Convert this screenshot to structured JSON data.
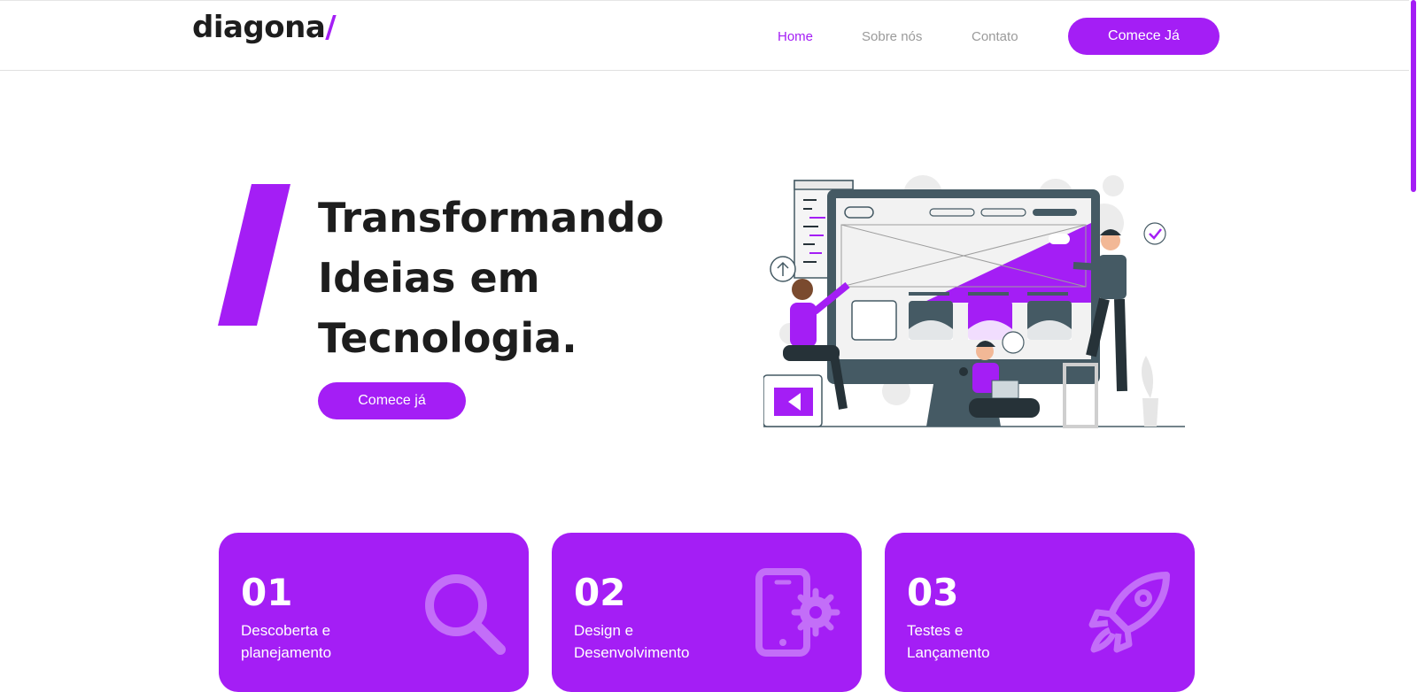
{
  "header": {
    "logo_text": "diagona",
    "logo_slash": "/",
    "nav": [
      {
        "label": "Home",
        "active": true
      },
      {
        "label": "Sobre nós",
        "active": false
      },
      {
        "label": "Contato",
        "active": false
      }
    ],
    "cta_label": "Comece Já"
  },
  "hero": {
    "title_lines": [
      "Transformando",
      "Ideias em",
      "Tecnologia."
    ],
    "cta_label": "Comece já",
    "illustration": "team-building-website-illustration"
  },
  "steps": [
    {
      "number": "01",
      "line1": "Descoberta e",
      "line2": "planejamento",
      "icon": "search-icon"
    },
    {
      "number": "02",
      "line1": "Design e",
      "line2": "Desenvolvimento",
      "icon": "mobile-settings-icon"
    },
    {
      "number": "03",
      "line1": "Testes e",
      "line2": "Lançamento",
      "icon": "rocket-icon"
    }
  ],
  "colors": {
    "brand": "#a41ef5",
    "text_dark": "#1d1d1d",
    "nav_inactive": "#9a9a9a",
    "icon_faded": "#c36ef8"
  }
}
